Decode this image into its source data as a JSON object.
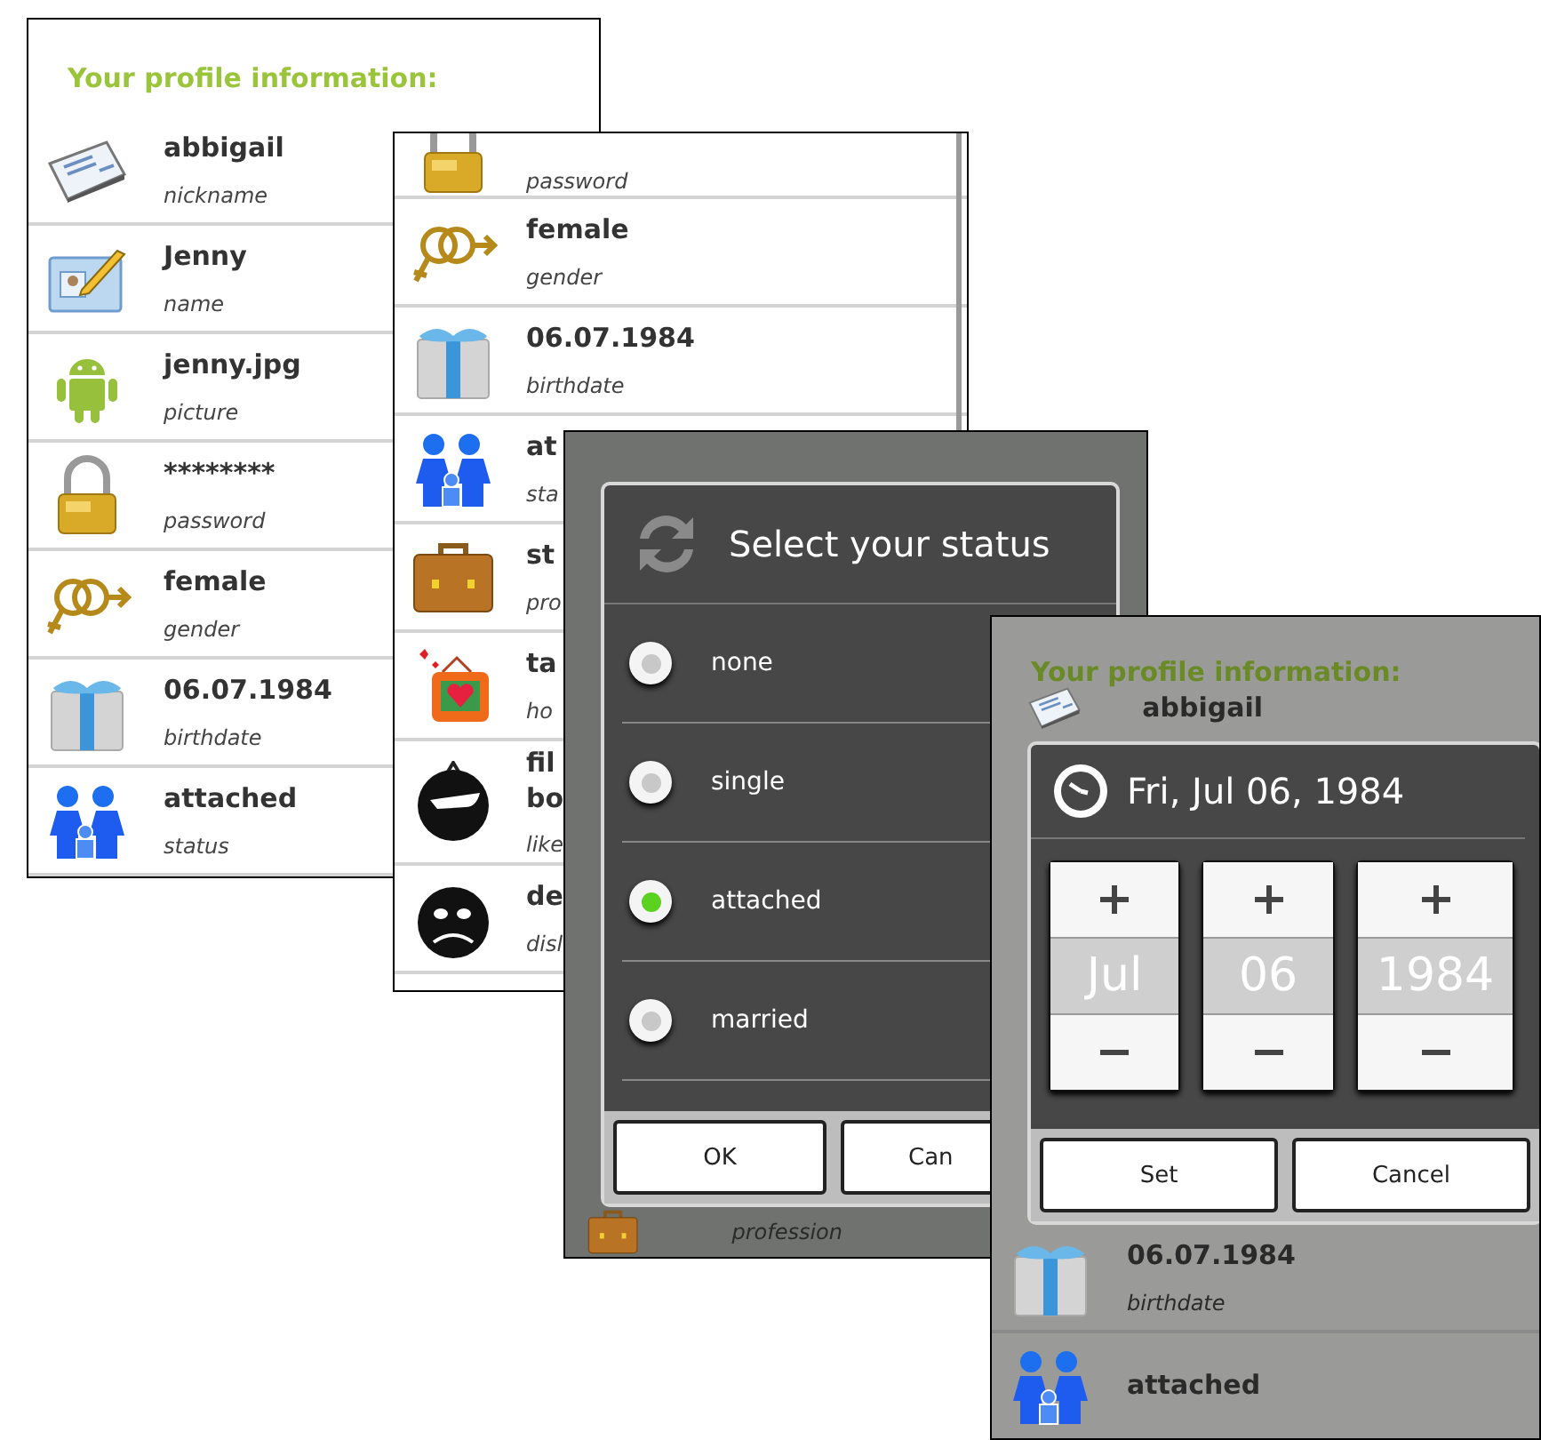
{
  "screens": [
    {
      "kind": "list",
      "title": "Your profile information:",
      "rows": [
        {
          "kind": "nickname",
          "value": "abbigail",
          "label": "nickname"
        },
        {
          "kind": "name",
          "value": "Jenny",
          "label": "name"
        },
        {
          "kind": "picture",
          "value": "jenny.jpg",
          "label": "picture"
        },
        {
          "kind": "password",
          "value": "********",
          "label": "password"
        },
        {
          "kind": "gender",
          "value": "female",
          "label": "gender"
        },
        {
          "kind": "birthdate",
          "value": "06.07.1984",
          "label": "birthdate"
        },
        {
          "kind": "status",
          "value": "attached",
          "label": "status"
        }
      ]
    },
    {
      "kind": "list",
      "rows": [
        {
          "kind": "password",
          "label": "password"
        },
        {
          "kind": "gender",
          "value": "female",
          "label": "gender"
        },
        {
          "kind": "birthdate",
          "value": "06.07.1984",
          "label": "birthdate"
        },
        {
          "kind": "status",
          "value": "at",
          "label": "sta"
        },
        {
          "kind": "profession",
          "value": "st",
          "label": "pro"
        },
        {
          "kind": "hobby",
          "value": "ta",
          "label": "ho"
        },
        {
          "kind": "like",
          "value": "fil bo",
          "label": "like"
        },
        {
          "kind": "dislike",
          "value": "de",
          "label": "disl"
        }
      ]
    },
    {
      "kind": "choice",
      "dialog": {
        "title": "Select your status",
        "options": [
          {
            "label": "none",
            "selected": false
          },
          {
            "label": "single",
            "selected": false
          },
          {
            "label": "attached",
            "selected": true
          },
          {
            "label": "married",
            "selected": false
          }
        ],
        "buttons": [
          "OK",
          "Can"
        ]
      },
      "rows": [
        {
          "kind": "profession",
          "label": "profession"
        }
      ]
    },
    {
      "kind": "date",
      "title": "Your profile information:",
      "top_rows": [
        {
          "kind": "nickname",
          "value": "abbigail"
        }
      ],
      "dialog": {
        "title": "Fri, Jul 06, 1984",
        "fields": [
          "Jul",
          "06",
          "1984"
        ],
        "buttons": [
          "Set",
          "Cancel"
        ]
      },
      "rows": [
        {
          "kind": "birthdate",
          "value": "06.07.1984",
          "label": "birthdate"
        },
        {
          "kind": "status",
          "value": "attached"
        }
      ]
    }
  ]
}
